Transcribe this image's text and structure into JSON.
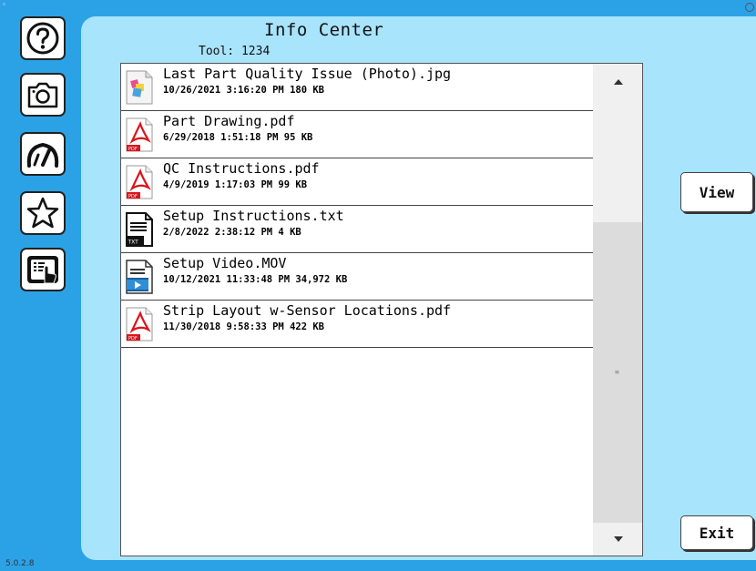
{
  "header": {
    "title": "Info Center",
    "tool": "Tool: 1234"
  },
  "sidebar": [
    {
      "icon": "help-icon"
    },
    {
      "icon": "camera-icon"
    },
    {
      "icon": "gauge-icon"
    },
    {
      "icon": "star-icon"
    },
    {
      "icon": "touch-screen-icon"
    }
  ],
  "files": [
    {
      "name": "Last Part Quality Issue (Photo).jpg",
      "meta": "10/26/2021 3:16:20 PM  180 KB",
      "type": "image-file-icon"
    },
    {
      "name": "Part Drawing.pdf",
      "meta": "6/29/2018 1:51:18 PM  95 KB",
      "type": "pdf-file-icon"
    },
    {
      "name": "QC Instructions.pdf",
      "meta": "4/9/2019 1:17:03 PM  99 KB",
      "type": "pdf-file-icon"
    },
    {
      "name": "Setup Instructions.txt",
      "meta": "2/8/2022 2:38:12 PM  4 KB",
      "type": "txt-file-icon"
    },
    {
      "name": "Setup Video.MOV",
      "meta": "10/12/2021 11:33:48 PM  34,972 KB",
      "type": "video-file-icon"
    },
    {
      "name": "Strip Layout w-Sensor Locations.pdf",
      "meta": "11/30/2018 9:58:33 PM  422 KB",
      "type": "pdf-file-icon"
    }
  ],
  "buttons": {
    "view": "View",
    "exit": "Exit"
  },
  "footer": {
    "version": "5.0.2.8"
  },
  "colors": {
    "background": "#2ba2e6",
    "panel": "#a8e4fb",
    "pdf": "#d9151c"
  }
}
